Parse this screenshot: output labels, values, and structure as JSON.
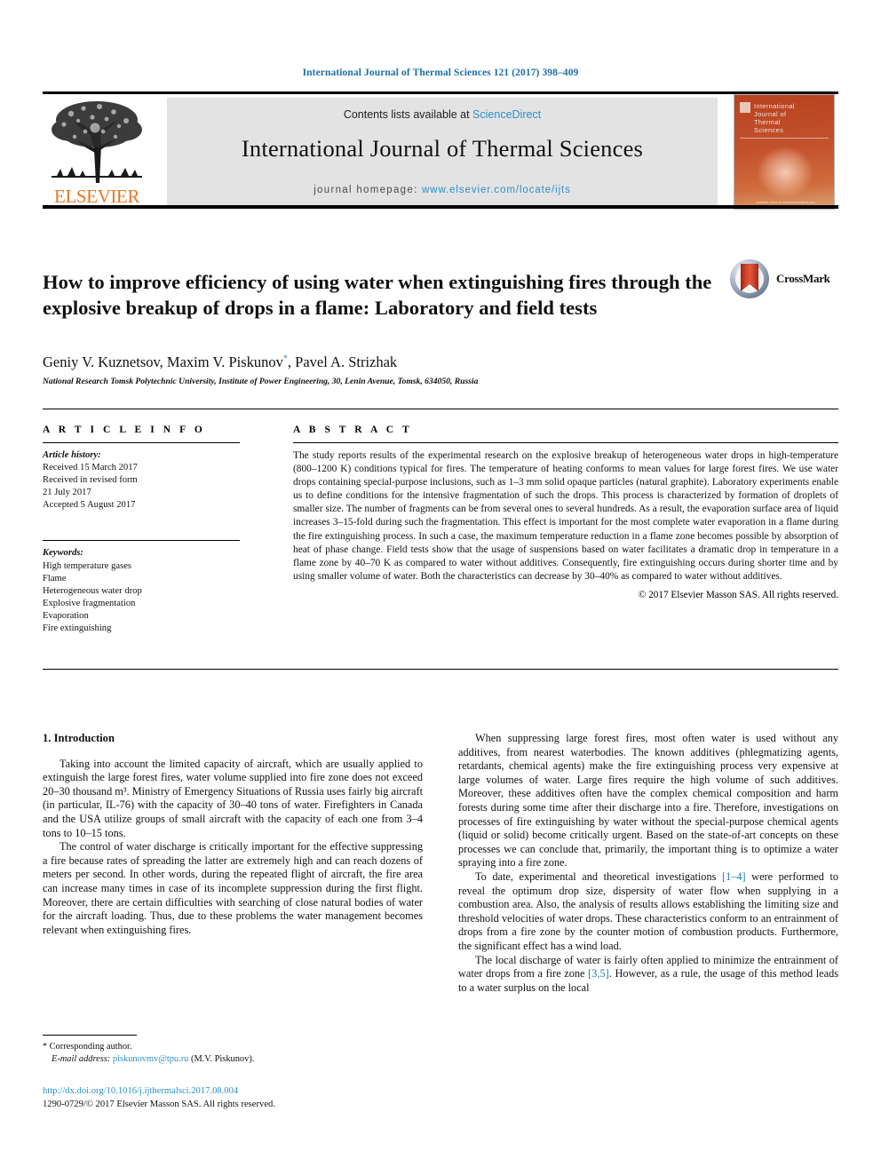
{
  "running_head": "International Journal of Thermal Sciences 121 (2017) 398–409",
  "masthead": {
    "contents_prefix": "Contents lists available at ",
    "sciencedirect": "ScienceDirect",
    "journal_title": "International Journal of Thermal Sciences",
    "homepage_prefix": "journal homepage: ",
    "homepage_url": "www.elsevier.com/locate/ijts",
    "publisher_wordmark": "ELSEVIER",
    "cover_title_lines": [
      "International",
      "Journal of",
      "Thermal",
      "Sciences"
    ],
    "cover_footer": "available online at www.sciencedirect.com",
    "colors": {
      "link": "#2c8fc9",
      "elsevier_orange": "#e87722",
      "cover_red": "#c1452a",
      "panel_grey": "#e3e3e3"
    }
  },
  "article": {
    "title": "How to improve efficiency of using water when extinguishing fires through the explosive breakup of drops in a flame: Laboratory and field tests",
    "authors_pre": "Geniy V. Kuznetsov, Maxim V. Piskunov",
    "authors_marker": "*",
    "authors_post": ", Pavel A. Strizhak",
    "affiliation": "National Research Tomsk Polytechnic University, Institute of Power Engineering, 30, Lenin Avenue, Tomsk, 634050, Russia",
    "crossmark_label": "CrossMark"
  },
  "article_info": {
    "heading": "A R T I C L E   I N F O",
    "history_label": "Article history:",
    "history_lines": [
      "Received 15 March 2017",
      "Received in revised form",
      "21 July 2017",
      "Accepted 5 August 2017"
    ],
    "keywords_label": "Keywords:",
    "keywords": [
      "High temperature gases",
      "Flame",
      "Heterogeneous water drop",
      "Explosive fragmentation",
      "Evaporation",
      "Fire extinguishing"
    ]
  },
  "abstract": {
    "heading": "A B S T R A C T",
    "text": "The study reports results of the experimental research on the explosive breakup of heterogeneous water drops in high-temperature (800–1200 K) conditions typical for fires. The temperature of heating conforms to mean values for large forest fires. We use water drops containing special-purpose inclusions, such as 1–3 mm solid opaque particles (natural graphite). Laboratory experiments enable us to define conditions for the intensive fragmentation of such the drops. This process is characterized by formation of droplets of smaller size. The number of fragments can be from several ones to several hundreds. As a result, the evaporation surface area of liquid increases 3–15-fold during such the fragmentation. This effect is important for the most complete water evaporation in a flame during the fire extinguishing process. In such a case, the maximum temperature reduction in a flame zone becomes possible by absorption of heat of phase change. Field tests show that the usage of suspensions based on water facilitates a dramatic drop in temperature in a flame zone by 40–70 K as compared to water without additives. Consequently, fire extinguishing occurs during shorter time and by using smaller volume of water. Both the characteristics can decrease by 30–40% as compared to water without additives.",
    "copyright": "© 2017 Elsevier Masson SAS. All rights reserved."
  },
  "body": {
    "section_heading": "1. Introduction",
    "left_paragraphs": [
      "Taking into account the limited capacity of aircraft, which are usually applied to extinguish the large forest fires, water volume supplied into fire zone does not exceed 20–30 thousand m³. Ministry of Emergency Situations of Russia uses fairly big aircraft (in particular, IL-76) with the capacity of 30–40 tons of water. Firefighters in Canada and the USA utilize groups of small aircraft with the capacity of each one from 3–4 tons to 10–15 tons.",
      "The control of water discharge is critically important for the effective suppressing a fire because rates of spreading the latter are extremely high and can reach dozens of meters per second. In other words, during the repeated flight of aircraft, the fire area can increase many times in case of its incomplete suppression during the first flight. Moreover, there are certain difficulties with searching of close natural bodies of water for the aircraft loading. Thus, due to these problems the water management becomes relevant when extinguishing fires."
    ],
    "right_paragraphs": [
      {
        "parts": [
          {
            "t": "When suppressing large forest fires, most often water is used without any additives, from nearest waterbodies. The known additives (phlegmatizing agents, retardants, chemical agents) make the fire extinguishing process very expensive at large volumes of water. Large fires require the high volume of such additives. Moreover, these additives often have the complex chemical composition and harm forests during some time after their discharge into a fire. Therefore, investigations on processes of fire extinguishing by water without the special-purpose chemical agents (liquid or solid) become critically urgent. Based on the state-of-art concepts on these processes we can conclude that, primarily, the important thing is to optimize a water spraying into a fire zone."
          }
        ]
      },
      {
        "parts": [
          {
            "t": "To date, experimental and theoretical investigations "
          },
          {
            "t": "[1–4]",
            "ref": true
          },
          {
            "t": " were performed to reveal the optimum drop size, dispersity of water flow when supplying in a combustion area. Also, the analysis of results allows establishing the limiting size and threshold velocities of water drops. These characteristics conform to an entrainment of drops from a fire zone by the counter motion of combustion products. Furthermore, the significant effect has a wind load."
          }
        ]
      },
      {
        "parts": [
          {
            "t": "The local discharge of water is fairly often applied to minimize the entrainment of water drops from a fire zone "
          },
          {
            "t": "[3,5]",
            "ref": true
          },
          {
            "t": ". However, as a rule, the usage of this method leads to a water surplus on the local"
          }
        ]
      }
    ]
  },
  "footer": {
    "corresponding_marker": "*",
    "corresponding_label": "Corresponding author.",
    "email_label": "E-mail address:",
    "email": "piskunovmv@tpu.ru",
    "email_owner": "(M.V. Piskunov).",
    "doi": "http://dx.doi.org/10.1016/j.ijthermalsci.2017.08.004",
    "issn_line": "1290-0729/© 2017 Elsevier Masson SAS. All rights reserved."
  }
}
